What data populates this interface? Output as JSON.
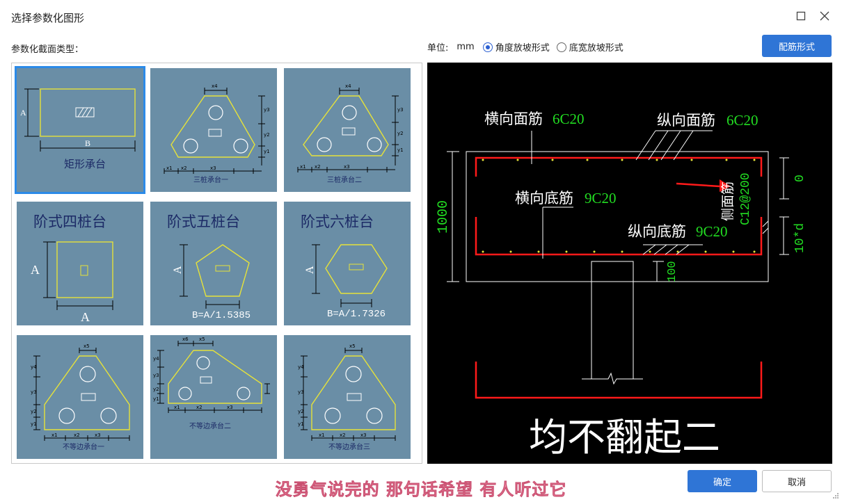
{
  "window": {
    "title": "选择参数化图形"
  },
  "labels": {
    "section_type": "参数化截面类型：",
    "unit_label": "单位:",
    "unit_value": "mm"
  },
  "options": {
    "angle_slope": "角度放坡形式",
    "width_slope": "底宽放坡形式",
    "selected": "angle_slope"
  },
  "buttons": {
    "rebar_form": "配筋形式",
    "ok": "确定",
    "cancel": "取消"
  },
  "shapes": {
    "rect": {
      "name": "矩形承台",
      "a": "A",
      "b": "B"
    },
    "tri1": {
      "name": "三桩承台一",
      "x4": "x4",
      "y1": "y1",
      "y2": "y2",
      "y3": "y3",
      "x1": "x1",
      "x2": "x2",
      "x3": "x3"
    },
    "tri2": {
      "name": "三桩承台二",
      "x4": "x4",
      "y1": "y1",
      "y2": "y2",
      "y3": "y3",
      "x1": "x1",
      "x2": "x2",
      "x3": "x3"
    },
    "step4": {
      "name": "阶式四桩台",
      "a": "A",
      "a2": "A"
    },
    "step5": {
      "name": "阶式五桩台",
      "a": "A",
      "b": "B=A/1.5385"
    },
    "step6": {
      "name": "阶式六桩台",
      "a": "A",
      "b": "B=A/1.7326"
    },
    "un1": {
      "name": "不等边承台一",
      "x5": "x5",
      "y1": "y1",
      "y2": "y2",
      "y3": "y3",
      "y4": "y4",
      "x1": "x1",
      "x2": "x2",
      "x3": "x3"
    },
    "un2": {
      "name": "不等边承台二",
      "x5": "x5",
      "x6": "x6",
      "y1": "y1",
      "y2": "y2",
      "y3": "y3",
      "y4": "y4",
      "x1": "x1",
      "x2": "x2",
      "x3": "x3"
    },
    "un3": {
      "name": "不等边承台三",
      "x5": "x5",
      "y1": "y1",
      "y2": "y2",
      "y3": "y3",
      "y4": "y4",
      "x1": "x1",
      "x2": "x2",
      "x3": "x3"
    }
  },
  "preview": {
    "top_trans": "横向面筋",
    "top_trans_val": "6C20",
    "top_long": "纵向面筋",
    "top_long_val": "6C20",
    "bot_trans": "横向底筋",
    "bot_trans_val": "9C20",
    "bot_long": "纵向底筋",
    "bot_long_val": "9C20",
    "side": "侧面筋",
    "side_val": "C12@200",
    "height": "1000",
    "cover_top": "0",
    "anchor": "10*d",
    "cover_bot": "100",
    "big_caption": "均不翻起二"
  },
  "subtitle": "没勇气说完的 那句话希望 有人听过它",
  "colors": {
    "accent": "#2f75d6",
    "cell_bg": "#6a8ea6",
    "shape_line": "#e6e23a",
    "rebar_red": "#ff1a1a",
    "dim_green": "#22dd22",
    "caption_pink": "#f18aa4"
  }
}
